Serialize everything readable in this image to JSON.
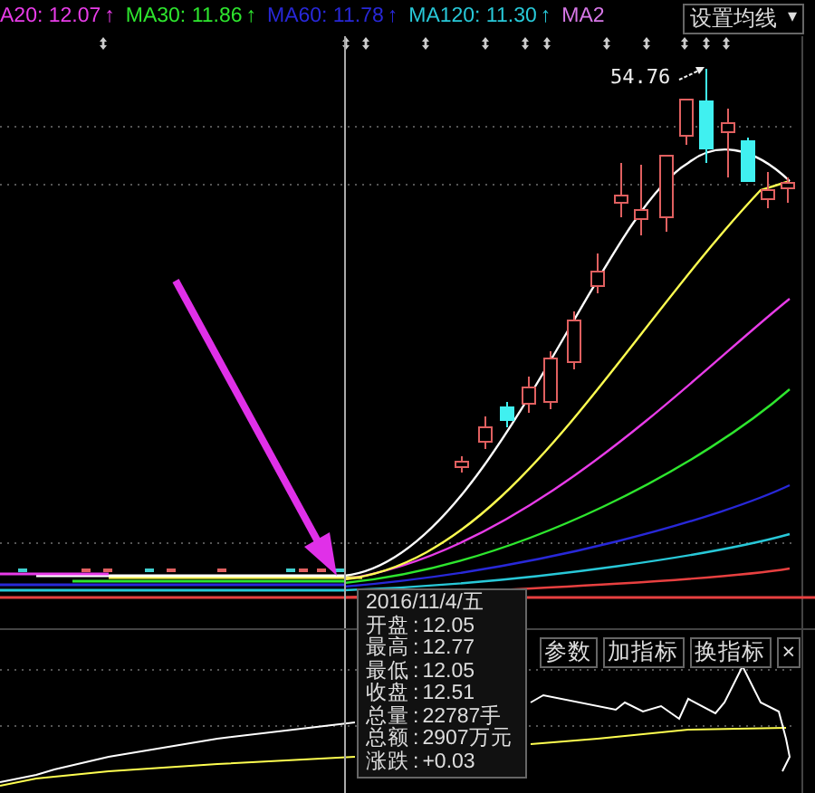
{
  "ma_legend": [
    {
      "label": "A20: 12.07",
      "arrow": "↑",
      "color": "#e83ce8"
    },
    {
      "label": "MA30: 11.86",
      "arrow": "↑",
      "color": "#2ee62e"
    },
    {
      "label": "MA60: 11.78",
      "arrow": "↑",
      "color": "#2828d8"
    },
    {
      "label": "MA120: 11.30",
      "arrow": "↑",
      "color": "#28c8d8"
    },
    {
      "label": "MA2",
      "color": "#d878e8"
    }
  ],
  "ma_settings_button": {
    "label": "设置均线",
    "caret": "▾"
  },
  "price_chart": {
    "peak_label": "54.76"
  },
  "tooltip": {
    "date": "2016/11/4/五",
    "rows": [
      {
        "label": "开盘",
        "separator": ":",
        "value": "12.05"
      },
      {
        "label": "最高",
        "separator": ":",
        "value": "12.77"
      },
      {
        "label": "最低",
        "separator": ":",
        "value": "12.05"
      },
      {
        "label": "收盘",
        "separator": ":",
        "value": "12.51"
      },
      {
        "label": "总量",
        "separator": ":",
        "value": "22787手"
      },
      {
        "label": "总额",
        "separator": ":",
        "value": "2907万元"
      },
      {
        "label": "涨跌",
        "separator": ":",
        "value": "+0.03"
      }
    ]
  },
  "indicator_buttons": [
    "参数",
    "加指标",
    "换指标",
    "×"
  ]
}
